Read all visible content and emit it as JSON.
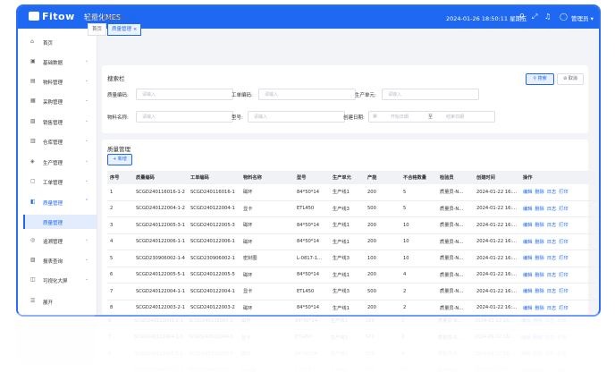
{
  "header": {
    "logo_text": "Fitow",
    "app_name": "轻量化MES",
    "datetime": "2024-01-26 18:50:11 星期五",
    "user": "管理员",
    "bg_color": "#1f68f2"
  },
  "sidebar": {
    "items": [
      {
        "label": "首页",
        "icon": "home-icon"
      },
      {
        "label": "基础数据",
        "icon": "database-icon"
      },
      {
        "label": "物料管理",
        "icon": "box-icon"
      },
      {
        "label": "采购管理",
        "icon": "cart-icon"
      },
      {
        "label": "销售管理",
        "icon": "sales-icon"
      },
      {
        "label": "仓库管理",
        "icon": "warehouse-icon"
      },
      {
        "label": "生产管理",
        "icon": "production-icon"
      },
      {
        "label": "工单管理",
        "icon": "workorder-icon"
      },
      {
        "label": "质量管理",
        "icon": "quality-icon",
        "active": true
      },
      {
        "label": "追溯管理",
        "icon": "trace-icon"
      },
      {
        "label": "报表查询",
        "icon": "report-icon"
      },
      {
        "label": "可视化大屏",
        "icon": "screen-icon"
      },
      {
        "label": "展开",
        "icon": "expand-icon"
      }
    ],
    "sub_item": "质量管理"
  },
  "breadcrumb": [
    "首页",
    "质量管理",
    "质量管理"
  ],
  "tabs": [
    "首页",
    "质量管理 ×"
  ],
  "search": {
    "title": "搜索栏",
    "search_btn": "搜索",
    "cancel_btn": "取消",
    "fields": [
      {
        "label": "质量编码:",
        "placeholder": "请输入"
      },
      {
        "label": "工单编码:",
        "placeholder": "请输入"
      },
      {
        "label": "生产单元:",
        "placeholder": "请输入"
      },
      {
        "label": "物料名称:",
        "placeholder": "请输入"
      },
      {
        "label": "型号:",
        "placeholder": "请输入"
      },
      {
        "label": "创建日期:",
        "start": "开始日期",
        "sep": "至",
        "end": "结束日期"
      }
    ]
  },
  "table": {
    "title": "质量管理",
    "add_btn": "+ 新增",
    "columns": [
      "序号",
      "质量编码",
      "工单编码",
      "物料名称",
      "型号",
      "生产单元",
      "产能",
      "不合格数量",
      "检验员",
      "创建时间",
      "操作"
    ],
    "ops": [
      "编辑",
      "删除",
      "日志",
      "打印"
    ],
    "rows": [
      [
        "1",
        "SCGD240116016-1-2",
        "SCGD240116016-1",
        "磁环",
        "84*50*14",
        "生产线1",
        "200",
        "5",
        "质量员-N...",
        "2024-01-22 16:..."
      ],
      [
        "2",
        "SCGD240122004-1-2",
        "SCGD240122004-1",
        "显卡",
        "ETL450",
        "生产线3",
        "500",
        "5",
        "质量员-N...",
        "2024-01-22 16:..."
      ],
      [
        "3",
        "SCGD240122005-3-1",
        "SCGD240122005-3",
        "磁环",
        "84*50*14",
        "生产线1",
        "200",
        "10",
        "质量员-N...",
        "2024-01-22 16:..."
      ],
      [
        "4",
        "SCGD240122006-1-1",
        "SCGD240122006-1",
        "磁环",
        "84*50*14",
        "生产线1",
        "200",
        "10",
        "质量员-N...",
        "2024-01-22 16:..."
      ],
      [
        "5",
        "SCGD230906002-1-4",
        "SCGD230906002-1",
        "密封圈",
        "L-0817-1...",
        "生产线3",
        "100",
        "10",
        "质量员-N...",
        "2024-01-22 16:..."
      ],
      [
        "6",
        "SCGD240122005-5-1",
        "SCGD240122005-5",
        "磁环",
        "84*50*14",
        "生产线1",
        "200",
        "4",
        "质量员-N...",
        "2024-01-22 16:..."
      ],
      [
        "7",
        "SCGD240122004-1-1",
        "SCGD240122004-1",
        "显卡",
        "ETL450",
        "生产线3",
        "500",
        "2",
        "质量员-N...",
        "2024-01-22 16:..."
      ],
      [
        "8",
        "SCGD240122003-2-1",
        "SCGD240122003-2",
        "磁环",
        "84*50*14",
        "生产线1",
        "200",
        "2",
        "质量员-N...",
        "2024-01-22 16:..."
      ]
    ]
  }
}
